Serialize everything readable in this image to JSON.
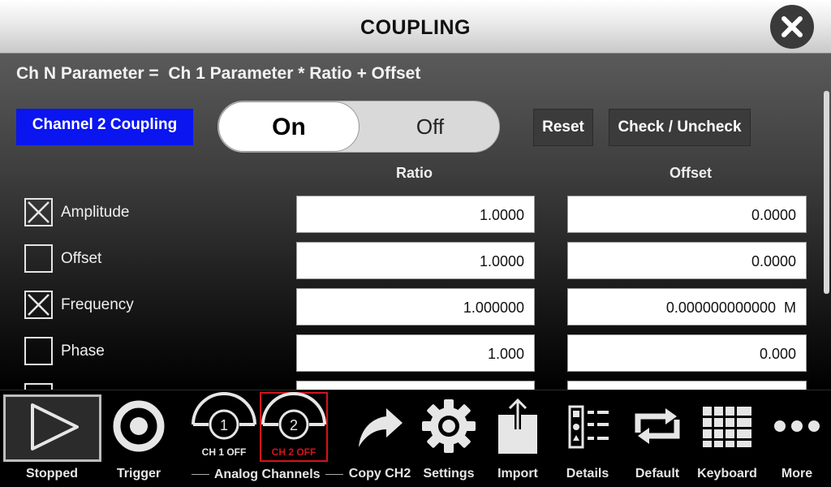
{
  "title": "COUPLING",
  "formula": "Ch N Parameter =  Ch 1 Parameter * Ratio + Offset",
  "channel_label": "Channel 2 Coupling",
  "toggle": {
    "on_label": "On",
    "off_label": "Off",
    "selected": "On"
  },
  "buttons": {
    "reset": "Reset",
    "check_uncheck": "Check / Uncheck"
  },
  "columns": {
    "ratio": "Ratio",
    "offset": "Offset"
  },
  "rows": [
    {
      "label": "Amplitude",
      "checked": true,
      "ratio": "1.0000",
      "offset": "0.0000"
    },
    {
      "label": "Offset",
      "checked": false,
      "ratio": "1.0000",
      "offset": "0.0000"
    },
    {
      "label": "Frequency",
      "checked": true,
      "ratio": "1.000000",
      "offset": "0.000000000000  M"
    },
    {
      "label": "Phase",
      "checked": false,
      "ratio": "1.000",
      "offset": "0.000"
    }
  ],
  "toolbar": {
    "stopped": "Stopped",
    "trigger": "Trigger",
    "ch1_number": "1",
    "ch1_state": "CH 1 OFF",
    "ch2_number": "2",
    "ch2_state": "CH 2 OFF",
    "analog_channels": "Analog Channels",
    "copy_ch2": "Copy CH2",
    "settings": "Settings",
    "import": "Import",
    "details": "Details",
    "default": "Default",
    "keyboard": "Keyboard",
    "more": "More"
  },
  "colors": {
    "channel_label_bg": "#0a15f0",
    "ch2_highlight": "#d4141a",
    "toolbar_icon": "#e6e6e6"
  }
}
